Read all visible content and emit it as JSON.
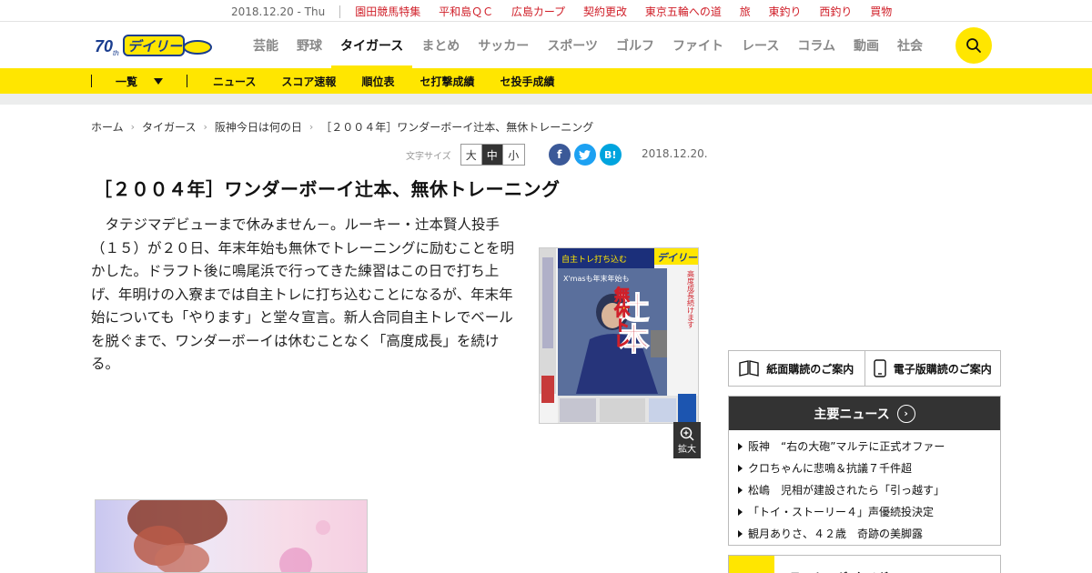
{
  "topstrip": {
    "date": "2018.12.20 - Thu",
    "links": [
      "園田競馬特集",
      "平和島ＱＣ",
      "広島カープ",
      "契約更改",
      "東京五輪への道",
      "旅",
      "東釣り",
      "西釣り",
      "買物"
    ]
  },
  "header": {
    "logo_text": "デイリー",
    "nav": [
      "芸能",
      "野球",
      "タイガース",
      "まとめ",
      "サッカー",
      "スポーツ",
      "ゴルフ",
      "ファイト",
      "レース",
      "コラム",
      "動画",
      "社会"
    ],
    "active_nav": "タイガース"
  },
  "subnav": {
    "list_label": "一覧",
    "items": [
      "ニュース",
      "スコア速報",
      "順位表",
      "セ打撃成績",
      "セ投手成績"
    ]
  },
  "breadcrumb": [
    "ホーム",
    "タイガース",
    "阪神今日は何の日",
    "［２００４年］ワンダーボーイ辻本、無休トレーニング"
  ],
  "tools": {
    "font_size_label": "文字サイズ",
    "sizes": [
      "大",
      "中",
      "小"
    ],
    "active_size": "中",
    "share": {
      "facebook": "f",
      "twitter": "t",
      "hatena": "B!"
    },
    "date": "2018.12.20."
  },
  "article": {
    "title": "［２００４年］ワンダーボーイ辻本、無休トレーニング",
    "body": "　タテジマデビューまで休みません－。ルーキー・辻本賢人投手（１５）が２０日、年末年始も無休でトレーニングに励むことを明かした。ドラフト後に鳴尾浜で行ってきた練習はこの日で打ち上げ、年明けの入寮までは自主トレに打ち込むことになるが、年末年始についても「やります」と堂々宣言。新人合同自主トレでベールを脱ぐまで、ワンダーボーイは休むことなく「高度成長」を続ける。",
    "zoom_label": "拡大"
  },
  "paper": {
    "masthead": "デイリー",
    "headline_big": "辻本",
    "headline_sub": "無休トレ",
    "caption": "X'masも年末年始も",
    "top": "自主トレ打ち込む",
    "side": "高度成長続けます"
  },
  "sidebar": {
    "subscribe": [
      "紙面購読のご案内",
      "電子版購読のご案内"
    ],
    "topnews_title": "主要ニュース",
    "topnews": [
      "阪神　“右の大砲”マルテに正式オファー",
      "クロちゃんに悲鳴＆抗議７千件超",
      "松嶋　児相が建設されたら「引っ越す」",
      "「トイ・ストーリー４」声優続投決定",
      "観月ありさ、４２歳　奇跡の美脚露"
    ],
    "ranking_title": "ランキング(タイガース)"
  },
  "colors": {
    "brand_yellow": "#ffe600",
    "link_red": "#d0202a",
    "dark": "#333333"
  }
}
